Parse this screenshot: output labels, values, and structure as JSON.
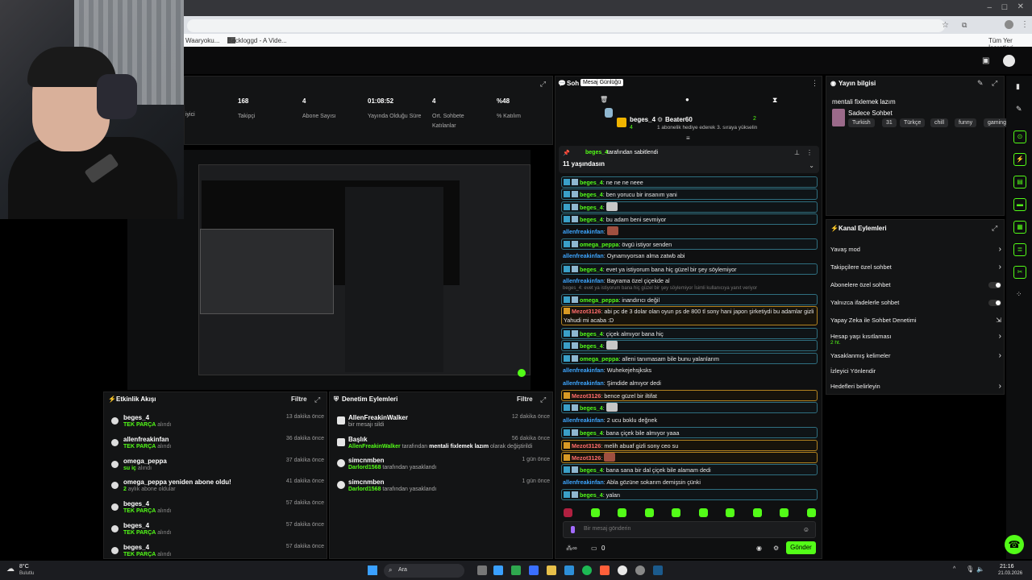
{
  "browser": {
    "bookmark1": "Waaryoku...",
    "bookmark2": "Backloggd - A Vide...",
    "all_bookmarks": "Tüm Yer İşaretleri"
  },
  "stats": [
    {
      "value": "168",
      "label": "Takipçi"
    },
    {
      "value": "4",
      "label": "Abone Sayısı"
    },
    {
      "value": "01:08:52",
      "label": "Yayında Olduğu Süre"
    },
    {
      "value": "4",
      "label": "Ort. Sohbete Katılanlar"
    },
    {
      "value": "%48",
      "label": "% Katılım"
    }
  ],
  "stats_partial": "iyici",
  "activity": {
    "title": "Etkinlik Akışı",
    "filter": "Filtre",
    "items": [
      {
        "name": "beges_4",
        "sub": "TEK PARÇA",
        "sub2": "alındı",
        "time": "13 dakika önce"
      },
      {
        "name": "allenfreakinfan",
        "sub": "TEK PARÇA",
        "sub2": "alındı",
        "time": "36 dakika önce"
      },
      {
        "name": "omega_peppa",
        "sub": "su iç",
        "sub2": "alındı",
        "time": "37 dakika önce"
      },
      {
        "name": "omega_peppa yeniden abone oldu!",
        "sub": "2",
        "sub2": "aylık abone oldular",
        "time": "41 dakika önce"
      },
      {
        "name": "beges_4",
        "sub": "TEK PARÇA",
        "sub2": "alındı",
        "time": "57 dakika önce"
      },
      {
        "name": "beges_4",
        "sub": "TEK PARÇA",
        "sub2": "alındı",
        "time": "57 dakika önce"
      },
      {
        "name": "beges_4",
        "sub": "TEK PARÇA",
        "sub2": "alındı",
        "time": "57 dakika önce"
      }
    ]
  },
  "moderation": {
    "title": "Denetim Eylemleri",
    "filter": "Filtre",
    "items": [
      {
        "name": "AllenFreakinWalker",
        "sub": "bir mesajı sildi",
        "time": "12 dakika önce"
      },
      {
        "name": "Başlık",
        "sub_user": "AllenFreakinWalker",
        "sub": "tarafından",
        "sub_bold": "mentali fixlemek lazım",
        "sub_end": "olarak değiştirildi",
        "time": "56 dakika önce"
      },
      {
        "name": "simcnmben",
        "sub_user": "Darlord1568",
        "sub": "tarafından yasaklandı",
        "time": "1 gün önce"
      },
      {
        "name": "simcnmben",
        "sub_user": "Darlord1568",
        "sub": "tarafından yasaklandı",
        "time": "1 gün önce"
      }
    ]
  },
  "chat": {
    "title": "Soh",
    "tooltip": "Mesaj Günlüğü",
    "gift_user1": "beges_4",
    "gift_count1": "4",
    "gift_user2": "Beater60",
    "gift_count2": "2",
    "gift_note": "1 abonelik hediye ederek 3. sıraya yükselin",
    "pinned_user": "beges_4",
    "pinned_by": "tarafından sabitlendi",
    "pinned_text": "11 yaşındasın",
    "messages": [
      {
        "u": "beges_4",
        "t": "ne ne ne neee",
        "c": "#53fc18",
        "hl": 1
      },
      {
        "u": "beges_4",
        "t": "ben yorucu bir insanım yani",
        "c": "#53fc18",
        "hl": 1
      },
      {
        "u": "beges_4",
        "t": "",
        "c": "#53fc18",
        "hl": 1,
        "emote": 1
      },
      {
        "u": "beges_4",
        "t": "bu adam beni sevmiyor",
        "c": "#53fc18",
        "hl": 1
      },
      {
        "u": "allenfreakinfan",
        "t": "",
        "c": "#3ea6ff",
        "hl": 0,
        "emote": 2
      },
      {
        "u": "omega_peppa",
        "t": "övgü istiyor senden",
        "c": "#53fc18",
        "hl": 1
      },
      {
        "u": "allenfreakinfan",
        "t": "Oynamıyorsan alma zatwb abi",
        "c": "#3ea6ff",
        "hl": 0
      },
      {
        "u": "beges_4",
        "t": "evet ya istiyorum bana hiç güzel bir şey söylemiyor",
        "c": "#53fc18",
        "hl": 1
      },
      {
        "u": "allenfreakinfan",
        "t": "Bayrama özel çiçekde al",
        "c": "#3ea6ff",
        "hl": 0
      },
      {
        "u": "omega_peppa",
        "t": "inandırıcı değil",
        "c": "#53fc18",
        "hl": 1,
        "reply": "beges_4: evet ya istiyorum bana hiç güzel bir şey söylemiyor İsimli kullanıcıya yanıt veriyor"
      },
      {
        "u": "Mezot3126",
        "t": "abi pc de 3 dolar olan oyun ps de 800 tl sony hani japon şirketiydi bu adamlar gizli",
        "t2": "Yahudi mi acaba :D",
        "c": "#ff6b6b",
        "hl": 2
      },
      {
        "u": "beges_4",
        "t": "çiçek almıyor bana hiç",
        "c": "#53fc18",
        "hl": 1
      },
      {
        "u": "beges_4",
        "t": "",
        "c": "#53fc18",
        "hl": 1,
        "emote": 1
      },
      {
        "u": "omega_peppa",
        "t": "alleni tanımasam bile bunu yalanlarım",
        "c": "#53fc18",
        "hl": 1
      },
      {
        "u": "allenfreakinfan",
        "t": "Wuhekejehsjksks",
        "c": "#3ea6ff",
        "hl": 0
      },
      {
        "u": "allenfreakinfan",
        "t": "Şimdide almıyor dedi",
        "c": "#3ea6ff",
        "hl": 0
      },
      {
        "u": "Mezot3126",
        "t": "bence güzel bir iltifat",
        "c": "#ff6b6b",
        "hl": 2
      },
      {
        "u": "beges_4",
        "t": "",
        "c": "#53fc18",
        "hl": 1,
        "emote": 1
      },
      {
        "u": "allenfreakinfan",
        "t": "2 ucu boklu değnek",
        "c": "#3ea6ff",
        "hl": 0
      },
      {
        "u": "beges_4",
        "t": "bana çiçek bile almıyor yaaa",
        "c": "#53fc18",
        "hl": 1
      },
      {
        "u": "Mezot3126",
        "t": "melih abuaf gizli sony ceo su",
        "c": "#ff6b6b",
        "hl": 2
      },
      {
        "u": "Mezot3126",
        "t": "",
        "c": "#ff6b6b",
        "hl": 2,
        "emote": 2
      },
      {
        "u": "beges_4",
        "t": "bana sana bir dal çiçek bile alamam dedi",
        "c": "#53fc18",
        "hl": 1
      },
      {
        "u": "allenfreakinfan",
        "t": "Abla gözüne sokarım demişsin çünki",
        "c": "#3ea6ff",
        "hl": 0
      },
      {
        "u": "beges_4",
        "t": "yalan",
        "c": "#53fc18",
        "hl": 1
      }
    ],
    "input_placeholder": "Bir mesaj gönderin",
    "send": "Gönder",
    "points": "0"
  },
  "stream_info": {
    "title": "Yayın bilgisi",
    "stream_title": "mentali fixlemek lazım",
    "category": "Sadece Sohbet",
    "tags": [
      "Turkish",
      "31",
      "Türkçe",
      "chill",
      "funny",
      "gaming"
    ]
  },
  "channel_actions": {
    "title": "Kanal Eylemleri",
    "items": [
      {
        "label": "Yavaş mod",
        "kind": "chev"
      },
      {
        "label": "Takipçilere özel sohbet",
        "kind": "chev"
      },
      {
        "label": "Abonelere özel sohbet",
        "kind": "tog"
      },
      {
        "label": "Yalnızca ifadelerle sohbet",
        "kind": "tog"
      },
      {
        "label": "Yapay Zeka ile Sohbet Denetimi",
        "kind": "ext"
      },
      {
        "label": "Hesap yaşı kısıtlaması",
        "sub": "2 ht.",
        "kind": "chev"
      },
      {
        "label": "Yasaklanmış kelimeler",
        "kind": "chev"
      },
      {
        "label": "İzleyici Yönlendir",
        "kind": "none"
      },
      {
        "label": "Hedefleri belirleyin",
        "kind": "chev"
      }
    ]
  },
  "taskbar": {
    "weather_temp": "8°C",
    "weather_desc": "Bulutlu",
    "search": "Ara",
    "time": "21:16",
    "date": "21.03.2026"
  },
  "colors": {
    "accent": "#53fc18",
    "panel": "#131415"
  }
}
